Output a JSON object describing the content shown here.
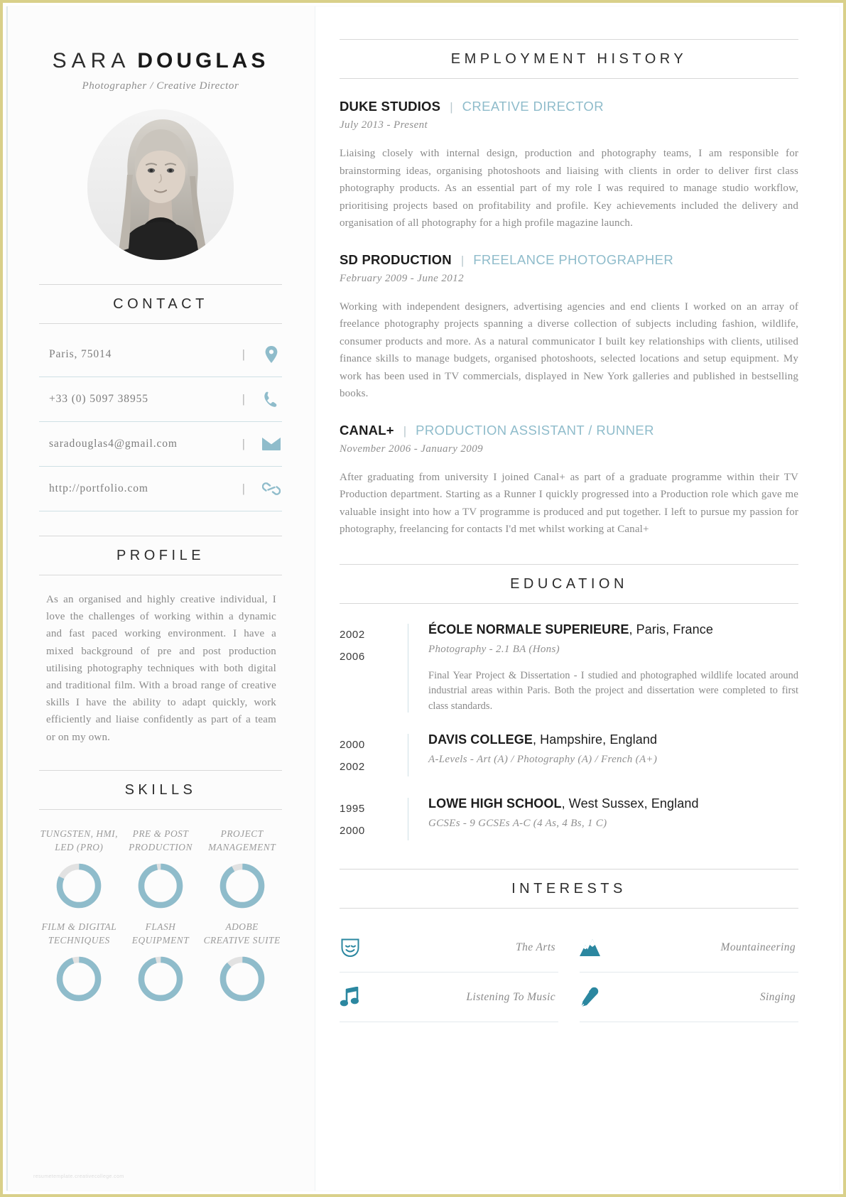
{
  "accent": "#8fbccb",
  "icon_teal": "#2b87a0",
  "header": {
    "name_first": "SARA",
    "name_last": "DOUGLAS",
    "job_title": "Photographer / Creative Director",
    "photo_alt": "portrait-photo"
  },
  "contact": {
    "heading": "CONTACT",
    "items": [
      {
        "text": "Paris, 75014",
        "icon": "location-pin-icon",
        "separator": "|"
      },
      {
        "text": "+33 (0) 5097 38955",
        "icon": "phone-icon",
        "separator": "|"
      },
      {
        "text": "saradouglas4@gmail.com",
        "icon": "envelope-icon",
        "separator": "|"
      },
      {
        "text": "http://portfolio.com",
        "icon": "link-icon",
        "separator": "|"
      }
    ]
  },
  "profile": {
    "heading": "PROFILE",
    "body": "As an organised and highly creative individual, I love the challenges of working within a dynamic and fast paced working environment. I have a mixed background of pre and post production utilising photography techniques with both digital and traditional film. With a broad range of creative skills I have the ability to adapt quickly, work efficiently and liaise confidently as part of a team or on my own."
  },
  "skills": {
    "heading": "SKILLS",
    "items": [
      {
        "label": "TUNGSTEN, HMI, LED (PRO)",
        "percent": 82
      },
      {
        "label": "PRE & POST PRODUCTION",
        "percent": 97
      },
      {
        "label": "PROJECT MANAGEMENT",
        "percent": 92
      },
      {
        "label": "FILM & DIGITAL TECHNIQUES",
        "percent": 95
      },
      {
        "label": "FLASH EQUIPMENT",
        "percent": 96
      },
      {
        "label": "ADOBE CREATIVE SUITE",
        "percent": 88
      }
    ]
  },
  "site_credit": "resumetemplate.creativecollege.com",
  "employment": {
    "heading": "EMPLOYMENT HISTORY",
    "jobs": [
      {
        "company": "DUKE STUDIOS",
        "separator": "|",
        "role": "CREATIVE DIRECTOR",
        "dates": "July 2013 - Present",
        "description": "Liaising closely with internal design, production and photography teams, I am responsible for brainstorming ideas, organising photoshoots and liaising with clients in order to deliver first class photography products.   As an essential part of my role I was required to manage studio workflow, prioritising projects based on profitability and profile.  Key achievements included the delivery and organisation of all photography for a high profile magazine launch."
      },
      {
        "company": "SD PRODUCTION",
        "separator": "|",
        "role": "FREELANCE PHOTOGRAPHER",
        "dates": "February 2009 - June 2012",
        "description": "Working with independent designers, advertising agencies and end clients I worked on an array of freelance photography projects spanning a diverse collection of subjects including fashion, wildlife, consumer products and more. As a natural communicator I built key relationships with clients, utilised finance skills to manage budgets, organised photoshoots, selected locations and setup equipment.   My work has been used in TV commercials, displayed in New York galleries and published in bestselling books."
      },
      {
        "company": "CANAL+",
        "separator": "|",
        "role": "PRODUCTION ASSISTANT / RUNNER",
        "dates": "November 2006 - January 2009",
        "description": "After graduating from university I joined Canal+ as part of a graduate programme within their TV Production department.  Starting as a Runner I quickly progressed into a Production role which gave me valuable insight into how a TV programme is produced and put together. I left to pursue my passion for photography, freelancing for contacts I'd met whilst working at Canal+"
      }
    ]
  },
  "education": {
    "heading": "EDUCATION",
    "entries": [
      {
        "year_start": "2002",
        "year_end": "2006",
        "school_bold": "ÉCOLE NORMALE SUPERIEURE",
        "school_rest": ", Paris, France",
        "qualification": "Photography - 2.1 BA (Hons)",
        "note": "Final Year Project & Dissertation - I studied and photographed wildlife located around industrial areas within Paris. Both the project and dissertation were completed to first class standards."
      },
      {
        "year_start": "2000",
        "year_end": "2002",
        "school_bold": "DAVIS COLLEGE",
        "school_rest": ", Hampshire, England",
        "qualification": "A-Levels - Art (A) / Photography (A) / French (A+)",
        "note": ""
      },
      {
        "year_start": "1995",
        "year_end": "2000",
        "school_bold": "LOWE HIGH SCHOOL",
        "school_rest": ", West Sussex, England",
        "qualification": "GCSEs - 9 GCSEs A-C (4 As, 4 Bs, 1 C)",
        "note": ""
      }
    ]
  },
  "interests": {
    "heading": "INTERESTS",
    "items": [
      {
        "label": "The Arts",
        "icon": "theatre-mask-icon"
      },
      {
        "label": "Mountaineering",
        "icon": "mountains-icon"
      },
      {
        "label": "Listening To Music",
        "icon": "music-note-icon"
      },
      {
        "label": "Singing",
        "icon": "microphone-icon"
      }
    ]
  }
}
